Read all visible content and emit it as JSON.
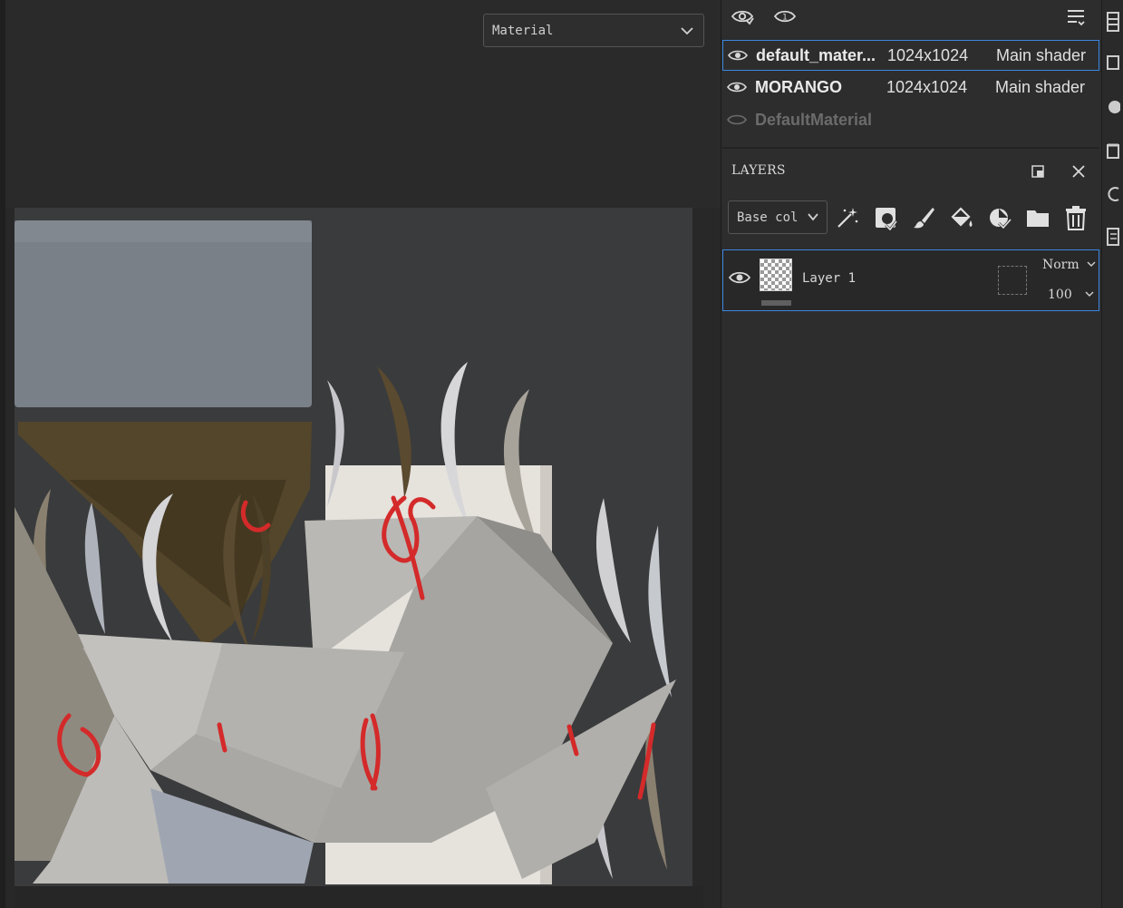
{
  "viewport": {
    "material_select": {
      "value": "Material"
    }
  },
  "texture_set_list": {
    "rows": [
      {
        "name": "default_mater...",
        "size": "1024x1024",
        "shader": "Main shader",
        "visible": true,
        "selected": true
      },
      {
        "name": "MORANGO",
        "size": "1024x1024",
        "shader": "Main shader",
        "visible": true,
        "selected": false
      },
      {
        "name": "DefaultMaterial",
        "size": "",
        "shader": "",
        "visible": false,
        "selected": false
      }
    ]
  },
  "layers_panel": {
    "title": "LAYERS",
    "channel_select": {
      "value": "Base col"
    },
    "tools": [
      "magic-wand-icon",
      "fill-mask-icon",
      "paint-brush-icon",
      "paint-bucket-icon",
      "smart-material-icon",
      "folder-icon",
      "trash-icon"
    ],
    "layers": [
      {
        "name": "Layer 1",
        "blend_mode": "Norm",
        "opacity": "100",
        "visible": true
      }
    ]
  },
  "colors": {
    "accent": "#3b86e0",
    "panel_bg": "#2d2d2d",
    "viewport_bg": "#282828"
  }
}
